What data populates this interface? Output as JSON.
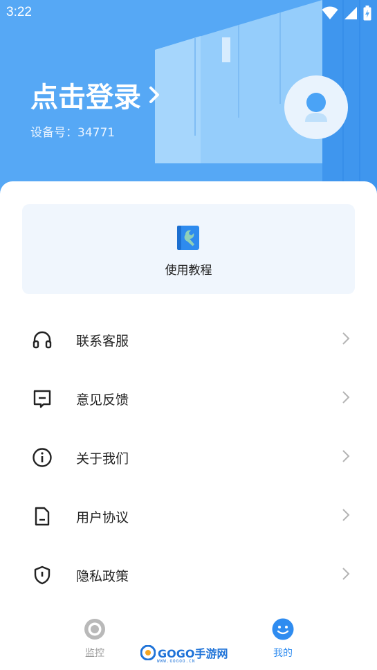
{
  "status_bar": {
    "time": "3:22"
  },
  "header": {
    "login_title": "点击登录",
    "device_label": "设备号：",
    "device_number": "34771"
  },
  "tutorial": {
    "label": "使用教程",
    "icon": "tutorial-book-wrench-icon"
  },
  "menu": {
    "items": [
      {
        "label": "联系客服",
        "icon": "headset-icon"
      },
      {
        "label": "意见反馈",
        "icon": "feedback-icon"
      },
      {
        "label": "关于我们",
        "icon": "info-icon"
      },
      {
        "label": "用户协议",
        "icon": "document-icon"
      },
      {
        "label": "隐私政策",
        "icon": "shield-icon"
      }
    ]
  },
  "bottom_nav": {
    "items": [
      {
        "label": "监控",
        "icon": "monitor-camera-icon",
        "active": false
      },
      {
        "label": "我的",
        "icon": "profile-face-icon",
        "active": true
      }
    ]
  },
  "watermark": {
    "text": "GOGO手游网",
    "sub": "WWW.GOGOO.CN"
  },
  "colors": {
    "header_blue": "#56a8f5",
    "accent_blue": "#2f8cf0",
    "text_dark": "#222222",
    "inactive_gray": "#9a9a9a"
  }
}
